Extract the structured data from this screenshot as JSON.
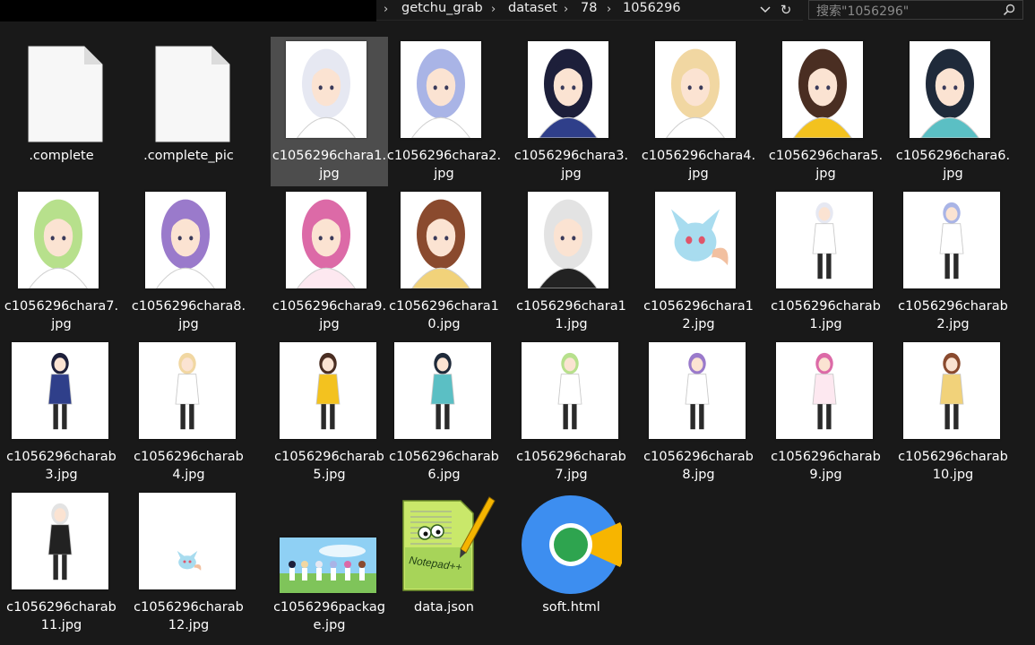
{
  "breadcrumb": [
    "getchu_grab",
    "dataset",
    "78",
    "1056296"
  ],
  "search": {
    "placeholder": "搜索\"1056296\""
  },
  "files": [
    {
      "name": ".complete",
      "kind": "doc"
    },
    {
      "name": ".complete_pic",
      "kind": "doc"
    },
    {
      "name": "c1056296chara1.jpg",
      "kind": "portrait",
      "hair": "#e6e8f2",
      "outfit": "#ffffff",
      "selected": true
    },
    {
      "name": "c1056296chara2.jpg",
      "kind": "portrait",
      "hair": "#a9b4e6",
      "outfit": "#ffffff"
    },
    {
      "name": "c1056296chara3.jpg",
      "kind": "portrait",
      "hair": "#1d1f3a",
      "outfit": "#2f3f8a"
    },
    {
      "name": "c1056296chara4.jpg",
      "kind": "portrait",
      "hair": "#f1d7a2",
      "outfit": "#ffffff"
    },
    {
      "name": "c1056296chara5.jpg",
      "kind": "portrait",
      "hair": "#4a2e22",
      "outfit": "#f3c21f"
    },
    {
      "name": "c1056296chara6.jpg",
      "kind": "portrait",
      "hair": "#1f2a3a",
      "outfit": "#5bbfc4"
    },
    {
      "name": "c1056296chara7.jpg",
      "kind": "portrait",
      "hair": "#b7e08c",
      "outfit": "#ffffff"
    },
    {
      "name": "c1056296chara8.jpg",
      "kind": "portrait",
      "hair": "#9a7acb",
      "outfit": "#ffffff"
    },
    {
      "name": "c1056296chara9.jpg",
      "kind": "portrait",
      "hair": "#dc6aa7",
      "outfit": "#fde8f0"
    },
    {
      "name": "c1056296chara10.jpg",
      "kind": "portrait",
      "hair": "#8a4a2e",
      "outfit": "#f1d27a"
    },
    {
      "name": "c1056296chara11.jpg",
      "kind": "portrait",
      "hair": "#e3e3e3",
      "outfit": "#222222"
    },
    {
      "name": "c1056296chara12.jpg",
      "kind": "creature",
      "hair": "#a8dcef",
      "outfit": "#ffffff"
    },
    {
      "name": "c1056296charab1.jpg",
      "kind": "full",
      "hair": "#e6e8f2",
      "outfit": "#ffffff"
    },
    {
      "name": "c1056296charab2.jpg",
      "kind": "full",
      "hair": "#a9b4e6",
      "outfit": "#ffffff"
    },
    {
      "name": "c1056296charab3.jpg",
      "kind": "full",
      "hair": "#1d1f3a",
      "outfit": "#2f3f8a"
    },
    {
      "name": "c1056296charab4.jpg",
      "kind": "full",
      "hair": "#f1d7a2",
      "outfit": "#ffffff"
    },
    {
      "name": "c1056296charab5.jpg",
      "kind": "full",
      "hair": "#4a2e22",
      "outfit": "#f3c21f"
    },
    {
      "name": "c1056296charab6.jpg",
      "kind": "full",
      "hair": "#1f2a3a",
      "outfit": "#5bbfc4"
    },
    {
      "name": "c1056296charab7.jpg",
      "kind": "full",
      "hair": "#b7e08c",
      "outfit": "#ffffff"
    },
    {
      "name": "c1056296charab8.jpg",
      "kind": "full",
      "hair": "#9a7acb",
      "outfit": "#ffffff"
    },
    {
      "name": "c1056296charab9.jpg",
      "kind": "full",
      "hair": "#dc6aa7",
      "outfit": "#fde8f0"
    },
    {
      "name": "c1056296charab10.jpg",
      "kind": "full",
      "hair": "#8a4a2e",
      "outfit": "#f1d27a"
    },
    {
      "name": "c1056296charab11.jpg",
      "kind": "full",
      "hair": "#e3e3e3",
      "outfit": "#222222"
    },
    {
      "name": "c1056296charab12.jpg",
      "kind": "tiny-creature",
      "hair": "#a8dcef",
      "outfit": "#ffffff"
    },
    {
      "name": "c1056296package.jpg",
      "kind": "package"
    },
    {
      "name": "data.json",
      "kind": "notepad",
      "icon_text": "Notepad++"
    },
    {
      "name": "soft.html",
      "kind": "browser"
    }
  ],
  "colors": {
    "background": "#191919",
    "selection": "#4d4d4d",
    "browser_blue": "#3d8ef0",
    "browser_yellow": "#f7b500",
    "browser_green": "#2ea44f"
  }
}
